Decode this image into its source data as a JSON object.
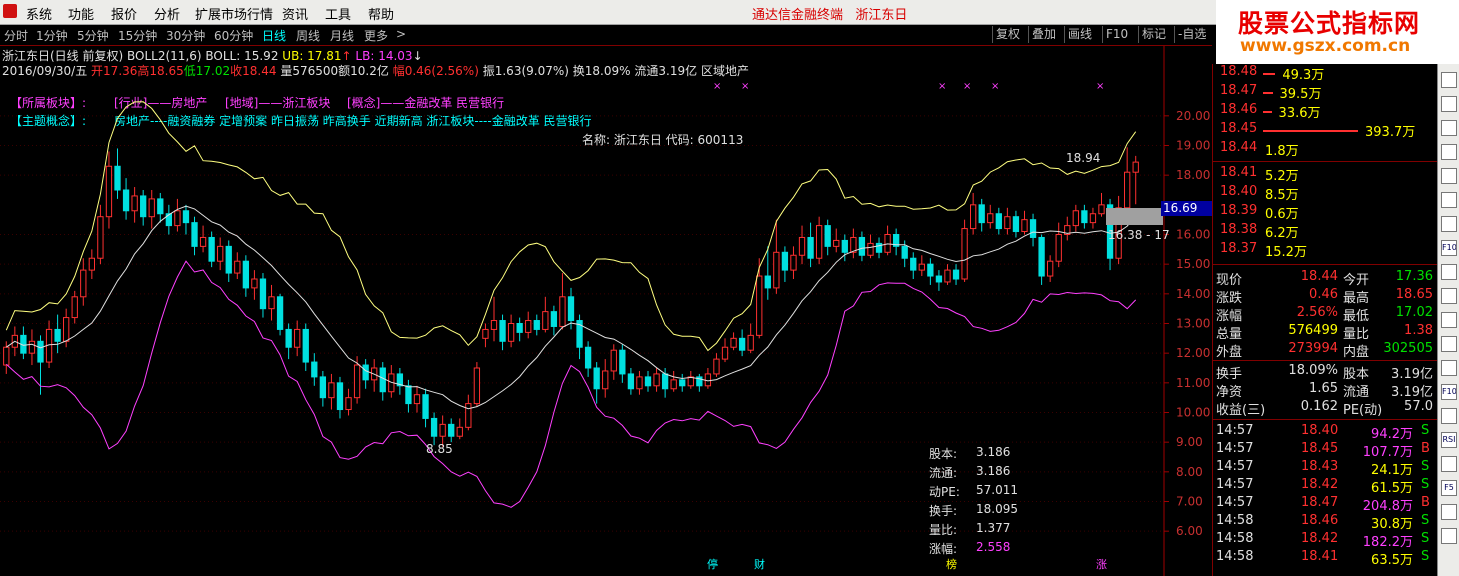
{
  "menu": {
    "items": [
      "系统",
      "功能",
      "报价",
      "分析",
      "扩展市场行情",
      "资讯",
      "工具",
      "帮助"
    ],
    "app_title": "通达信金融终端",
    "stock_title": "浙江东日"
  },
  "logo": {
    "line1": "股票公式指标网",
    "line2": "www.gszx.com.cn"
  },
  "periods": [
    "分时",
    "1分钟",
    "5分钟",
    "15分钟",
    "30分钟",
    "60分钟",
    "日线",
    "周线",
    "月线",
    "更多",
    ">"
  ],
  "active_period": "日线",
  "toolbar": [
    "复权",
    "叠加",
    "画线",
    "F10",
    "标记",
    "-自选"
  ],
  "header": {
    "title": "浙江东日(日线 前复权)",
    "indicator": "BOLL2(11,6)",
    "boll": "BOLL: 15.92",
    "ub": "UB: 17.81",
    "lb": "LB: 14.03",
    "date": "2016/09/30/五",
    "open": "开17.36",
    "high": "高18.65",
    "low": "低17.02",
    "close": "收18.44",
    "vol": "量576500",
    "amount": "额10.2亿",
    "change": "幅0.46(2.56%)",
    "amp": "振1.63(9.07%)",
    "turnover": "换18.09%",
    "float": "流通3.19亿",
    "region": "区域地产"
  },
  "concepts": {
    "sector_label": "【所属板块】:",
    "industry": "[行业]——房地产",
    "region": "[地域]——浙江板块",
    "concept": "[概念]——金融改革 民营银行",
    "theme_label": "【主题概念】:",
    "theme": "房地产----融资融券 定增预案 昨日振荡 昨高换手 近期新高 浙江板块----金融改革 民营银行"
  },
  "stock_name_label": "名称: 浙江东日 代码: 600113",
  "y_axis": [
    "20.00",
    "19.00",
    "18.00",
    "16.00",
    "15.00",
    "14.00",
    "13.00",
    "12.00",
    "11.00",
    "10.00",
    "9.00",
    "8.00",
    "7.00",
    "6.00"
  ],
  "annotations": {
    "high": "18.94",
    "low": "8.85",
    "range": "16.38 - 17",
    "current": "16.69"
  },
  "mini_stats": [
    {
      "k": "股本:",
      "v": "3.186"
    },
    {
      "k": "流通:",
      "v": "3.186"
    },
    {
      "k": "动PE:",
      "v": "57.011"
    },
    {
      "k": "换手:",
      "v": "18.095"
    },
    {
      "k": "量比:",
      "v": "1.377"
    },
    {
      "k": "涨幅:",
      "v": "2.558"
    }
  ],
  "bottom_markers": [
    "停",
    "财",
    "榜",
    "涨"
  ],
  "order_book": {
    "asks": [
      {
        "price": "18.48",
        "qty": "49.3万",
        "bar": 0.13
      },
      {
        "price": "18.47",
        "qty": "39.5万",
        "bar": 0.1
      },
      {
        "price": "18.46",
        "qty": "33.6万",
        "bar": 0.09
      },
      {
        "price": "18.45",
        "qty": "393.7万",
        "bar": 1.0
      },
      {
        "price": "18.44",
        "qty": "1.8万",
        "bar": 0.0
      }
    ],
    "bids": [
      {
        "price": "18.41",
        "qty": "5.2万"
      },
      {
        "price": "18.40",
        "qty": "8.5万"
      },
      {
        "price": "18.39",
        "qty": "0.6万"
      },
      {
        "price": "18.38",
        "qty": "6.2万"
      },
      {
        "price": "18.37",
        "qty": "15.2万"
      }
    ]
  },
  "quote_stats": [
    {
      "k1": "现价",
      "v1": "18.44",
      "c1": "#ff3030",
      "k2": "今开",
      "v2": "17.36",
      "c2": "#00e000"
    },
    {
      "k1": "涨跌",
      "v1": "0.46",
      "c1": "#ff3030",
      "k2": "最高",
      "v2": "18.65",
      "c2": "#ff3030"
    },
    {
      "k1": "涨幅",
      "v1": "2.56%",
      "c1": "#ff3030",
      "k2": "最低",
      "v2": "17.02",
      "c2": "#00e000"
    },
    {
      "k1": "总量",
      "v1": "576499",
      "c1": "#ffff00",
      "k2": "量比",
      "v2": "1.38",
      "c2": "#ff3030"
    },
    {
      "k1": "外盘",
      "v1": "273994",
      "c1": "#ff3030",
      "k2": "内盘",
      "v2": "302505",
      "c2": "#00e000"
    }
  ],
  "fund_stats": [
    {
      "k1": "换手",
      "v1": "18.09%",
      "k2": "股本",
      "v2": "3.19亿"
    },
    {
      "k1": "净资",
      "v1": "1.65",
      "k2": "流通",
      "v2": "3.19亿"
    },
    {
      "k1": "收益(三)",
      "v1": "0.162",
      "k2": "PE(动)",
      "v2": "57.0"
    }
  ],
  "ticks": [
    {
      "t": "14:57",
      "p": "18.40",
      "v": "94.2万",
      "vc": "#ff40ff",
      "bs": "S",
      "bc": "#00e000"
    },
    {
      "t": "14:57",
      "p": "18.45",
      "v": "107.7万",
      "vc": "#ff40ff",
      "bs": "B",
      "bc": "#ff3030"
    },
    {
      "t": "14:57",
      "p": "18.43",
      "v": "24.1万",
      "vc": "#ffff00",
      "bs": "S",
      "bc": "#00e000"
    },
    {
      "t": "14:57",
      "p": "18.42",
      "v": "61.5万",
      "vc": "#ffff00",
      "bs": "S",
      "bc": "#00e000"
    },
    {
      "t": "14:57",
      "p": "18.47",
      "v": "204.8万",
      "vc": "#ff40ff",
      "bs": "B",
      "bc": "#ff3030"
    },
    {
      "t": "14:58",
      "p": "18.46",
      "v": "30.8万",
      "vc": "#ffff00",
      "bs": "S",
      "bc": "#00e000"
    },
    {
      "t": "14:58",
      "p": "18.42",
      "v": "182.2万",
      "vc": "#ff40ff",
      "bs": "S",
      "bc": "#00e000"
    },
    {
      "t": "14:58",
      "p": "18.41",
      "v": "63.5万",
      "vc": "#ffff00",
      "bs": "S",
      "bc": "#00e000"
    }
  ],
  "right_toolbar": [
    "RSI",
    "F5",
    "F10"
  ],
  "colors": {
    "up": "#ff3030",
    "down": "#00e0e0",
    "mid_band": "#e0e0e0",
    "upper_band": "#ffff80",
    "lower_band": "#ff40ff"
  },
  "chart_data": {
    "type": "candlestick",
    "title": "",
    "y_range": [
      5.5,
      20.5
    ],
    "candles": [
      [
        11.6,
        12.2,
        12.4,
        11.3
      ],
      [
        12.2,
        12.6,
        12.9,
        11.9
      ],
      [
        12.6,
        12.0,
        12.9,
        11.8
      ],
      [
        12.0,
        12.4,
        12.8,
        11.6
      ],
      [
        12.4,
        11.7,
        12.6,
        10.6
      ],
      [
        11.7,
        12.8,
        13.1,
        11.5
      ],
      [
        12.8,
        12.4,
        13.3,
        12.0
      ],
      [
        12.4,
        13.2,
        13.5,
        12.2
      ],
      [
        13.2,
        13.9,
        14.1,
        13.0
      ],
      [
        13.9,
        14.8,
        15.2,
        13.6
      ],
      [
        14.8,
        15.2,
        15.5,
        14.5
      ],
      [
        15.2,
        16.6,
        17.0,
        15.0
      ],
      [
        16.6,
        18.3,
        18.8,
        16.2
      ],
      [
        18.3,
        17.5,
        18.9,
        17.2
      ],
      [
        17.5,
        16.8,
        17.9,
        16.5
      ],
      [
        16.8,
        17.3,
        17.6,
        16.4
      ],
      [
        17.3,
        16.6,
        17.5,
        16.3
      ],
      [
        16.6,
        17.2,
        17.5,
        16.2
      ],
      [
        17.2,
        16.7,
        17.4,
        16.4
      ],
      [
        16.7,
        16.3,
        17.0,
        16.0
      ],
      [
        16.3,
        16.8,
        17.2,
        16.1
      ],
      [
        16.8,
        16.4,
        17.0,
        16.0
      ],
      [
        16.4,
        15.6,
        16.6,
        15.3
      ],
      [
        15.6,
        15.9,
        16.3,
        15.4
      ],
      [
        15.9,
        15.1,
        16.1,
        14.9
      ],
      [
        15.1,
        15.6,
        15.9,
        14.8
      ],
      [
        15.6,
        14.7,
        15.8,
        14.4
      ],
      [
        14.7,
        15.1,
        15.4,
        14.5
      ],
      [
        15.1,
        14.2,
        15.3,
        13.9
      ],
      [
        14.2,
        14.5,
        14.8,
        13.8
      ],
      [
        14.5,
        13.5,
        14.7,
        13.2
      ],
      [
        13.5,
        13.9,
        14.3,
        13.1
      ],
      [
        13.9,
        12.8,
        14.0,
        12.6
      ],
      [
        12.8,
        12.2,
        13.0,
        11.8
      ],
      [
        12.2,
        12.8,
        13.1,
        11.9
      ],
      [
        12.8,
        11.7,
        13.0,
        11.4
      ],
      [
        11.7,
        11.2,
        12.0,
        10.9
      ],
      [
        11.2,
        10.5,
        11.4,
        10.2
      ],
      [
        10.5,
        11.0,
        11.3,
        10.1
      ],
      [
        11.0,
        10.1,
        11.2,
        9.8
      ],
      [
        10.1,
        10.5,
        10.8,
        9.9
      ],
      [
        10.5,
        11.6,
        11.9,
        10.3
      ],
      [
        11.6,
        11.1,
        11.8,
        10.8
      ],
      [
        11.1,
        11.5,
        11.8,
        10.7
      ],
      [
        11.5,
        10.7,
        11.7,
        10.4
      ],
      [
        10.7,
        11.3,
        11.6,
        10.5
      ],
      [
        11.3,
        10.9,
        11.5,
        10.6
      ],
      [
        10.9,
        10.3,
        11.1,
        10.0
      ],
      [
        10.3,
        10.6,
        10.9,
        10.0
      ],
      [
        10.6,
        9.8,
        10.8,
        9.5
      ],
      [
        9.8,
        9.2,
        10.0,
        8.9
      ],
      [
        9.2,
        9.6,
        9.9,
        8.85
      ],
      [
        9.6,
        9.2,
        9.8,
        9.0
      ],
      [
        9.2,
        9.5,
        9.8,
        9.1
      ],
      [
        9.5,
        10.3,
        10.6,
        9.4
      ],
      [
        10.3,
        11.5,
        11.7,
        10.2
      ],
      [
        12.5,
        12.8,
        13.0,
        12.2
      ],
      [
        12.8,
        13.1,
        13.9,
        12.4
      ],
      [
        13.1,
        12.4,
        13.3,
        12.1
      ],
      [
        12.4,
        13.0,
        13.3,
        12.2
      ],
      [
        13.0,
        12.7,
        13.2,
        12.4
      ],
      [
        12.7,
        13.1,
        13.4,
        12.5
      ],
      [
        13.1,
        12.8,
        13.3,
        12.6
      ],
      [
        12.8,
        13.4,
        13.9,
        12.7
      ],
      [
        13.4,
        12.9,
        13.6,
        12.6
      ],
      [
        12.9,
        13.9,
        14.7,
        12.8
      ],
      [
        13.9,
        13.1,
        14.2,
        12.8
      ],
      [
        13.1,
        12.2,
        13.3,
        11.8
      ],
      [
        12.2,
        11.5,
        12.4,
        11.2
      ],
      [
        11.5,
        10.8,
        11.7,
        10.3
      ],
      [
        10.8,
        11.4,
        11.8,
        10.5
      ],
      [
        11.4,
        12.1,
        12.3,
        11.1
      ],
      [
        12.1,
        11.3,
        12.3,
        11.0
      ],
      [
        11.3,
        10.8,
        11.5,
        10.6
      ],
      [
        10.8,
        11.2,
        11.4,
        10.6
      ],
      [
        11.2,
        10.9,
        11.4,
        10.7
      ],
      [
        10.9,
        11.3,
        11.5,
        10.7
      ],
      [
        11.3,
        10.8,
        11.5,
        10.5
      ],
      [
        10.8,
        11.1,
        11.4,
        10.7
      ],
      [
        11.1,
        10.9,
        11.3,
        10.7
      ],
      [
        10.9,
        11.2,
        11.4,
        10.8
      ],
      [
        11.2,
        10.9,
        11.3,
        10.7
      ],
      [
        10.9,
        11.3,
        11.5,
        10.8
      ],
      [
        11.3,
        11.8,
        12.0,
        11.2
      ],
      [
        11.8,
        12.2,
        12.5,
        11.7
      ],
      [
        12.2,
        12.5,
        12.7,
        12.1
      ],
      [
        12.5,
        12.1,
        12.8,
        11.9
      ],
      [
        12.1,
        12.6,
        13.0,
        12.0
      ],
      [
        12.6,
        14.6,
        15.2,
        12.5
      ],
      [
        14.6,
        14.2,
        15.6,
        13.8
      ],
      [
        14.2,
        15.4,
        16.5,
        14.0
      ],
      [
        15.4,
        14.8,
        15.6,
        14.4
      ],
      [
        14.8,
        15.3,
        15.6,
        14.5
      ],
      [
        15.3,
        15.9,
        16.3,
        15.0
      ],
      [
        15.9,
        15.2,
        16.4,
        14.9
      ],
      [
        15.2,
        16.3,
        16.6,
        15.0
      ],
      [
        16.3,
        15.6,
        16.5,
        15.3
      ],
      [
        15.6,
        15.8,
        16.2,
        15.4
      ],
      [
        15.8,
        15.4,
        16.0,
        15.1
      ],
      [
        15.4,
        15.9,
        16.2,
        15.2
      ],
      [
        15.9,
        15.3,
        16.1,
        15.1
      ],
      [
        15.3,
        15.7,
        16.0,
        15.2
      ],
      [
        15.7,
        15.4,
        15.9,
        15.2
      ],
      [
        15.4,
        16.0,
        16.3,
        15.3
      ],
      [
        16.0,
        15.6,
        16.2,
        15.3
      ],
      [
        15.6,
        15.2,
        15.8,
        14.9
      ],
      [
        15.2,
        14.8,
        15.4,
        14.5
      ],
      [
        14.8,
        15.0,
        15.3,
        14.6
      ],
      [
        15.0,
        14.6,
        15.2,
        14.3
      ],
      [
        14.6,
        14.4,
        14.8,
        14.1
      ],
      [
        14.4,
        14.8,
        15.0,
        14.3
      ],
      [
        14.8,
        14.5,
        15.0,
        14.3
      ],
      [
        14.5,
        16.2,
        16.5,
        14.4
      ],
      [
        16.2,
        17.0,
        17.4,
        16.0
      ],
      [
        17.0,
        16.4,
        17.2,
        16.1
      ],
      [
        16.4,
        16.7,
        17.0,
        16.2
      ],
      [
        16.7,
        16.2,
        16.9,
        16.0
      ],
      [
        16.2,
        16.6,
        16.9,
        16.0
      ],
      [
        16.6,
        16.1,
        16.8,
        15.9
      ],
      [
        16.1,
        16.5,
        16.8,
        16.0
      ],
      [
        16.5,
        15.9,
        16.7,
        15.6
      ],
      [
        15.9,
        14.6,
        16.0,
        14.3
      ],
      [
        14.6,
        15.1,
        15.3,
        14.4
      ],
      [
        15.1,
        16.0,
        16.4,
        14.9
      ],
      [
        16.0,
        16.3,
        16.6,
        15.8
      ],
      [
        16.3,
        16.8,
        17.0,
        16.1
      ],
      [
        16.8,
        16.4,
        17.0,
        16.2
      ],
      [
        16.4,
        16.7,
        16.9,
        16.2
      ],
      [
        16.7,
        17.0,
        17.4,
        16.6
      ],
      [
        17.0,
        15.2,
        17.2,
        14.8
      ],
      [
        15.2,
        16.9,
        17.3,
        15.0
      ],
      [
        16.9,
        18.1,
        18.94,
        16.8
      ],
      [
        18.1,
        18.44,
        18.65,
        17.02
      ]
    ]
  }
}
